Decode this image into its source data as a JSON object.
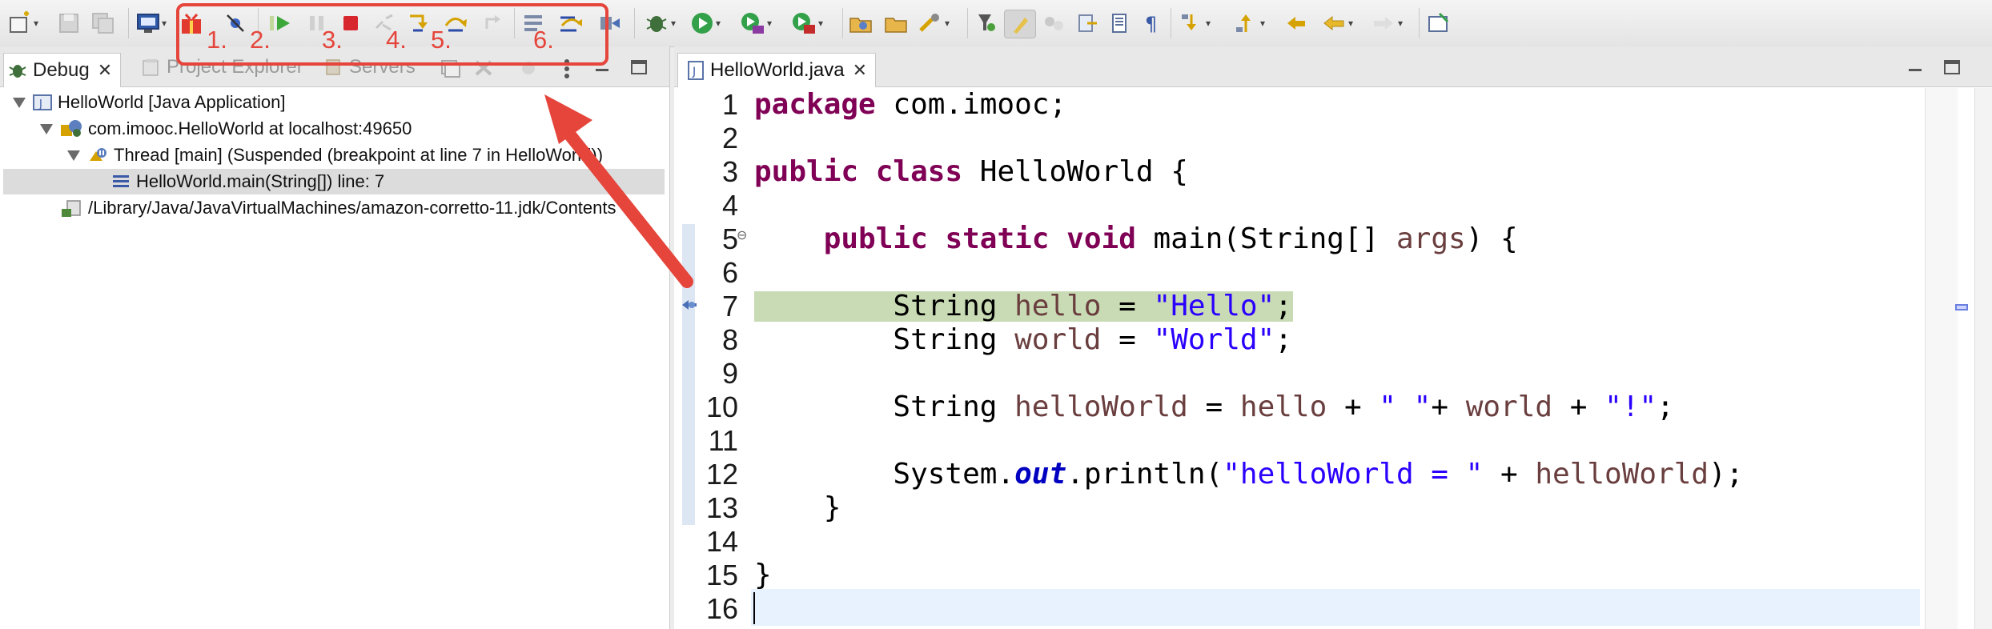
{
  "toolbar": {
    "icons": [
      "new-wizard-icon",
      "save-icon",
      "save-all-icon",
      "terminal-icon",
      "package-gift-icon",
      "skip-breakpoints-icon",
      "resume-icon",
      "suspend-icon",
      "terminate-icon",
      "disconnect-icon",
      "step-into-icon",
      "step-over-icon",
      "step-return-icon",
      "drop-to-frame-icon",
      "use-step-filters-icon",
      "debug-icon",
      "run-icon",
      "coverage-icon",
      "external-tools-icon",
      "open-type-icon",
      "open-folder-icon",
      "search-icon",
      "toggle-mark-occurrences-icon",
      "highlight-icon",
      "show-whitespace-icon",
      "next-annotation-icon",
      "previous-annotation-icon",
      "back-icon",
      "forward-icon",
      "pin-editor-icon"
    ]
  },
  "annotation": {
    "color": "#e5453b",
    "numbers": [
      "1.",
      "2.",
      "3.",
      "4.",
      "5.",
      "6."
    ]
  },
  "left_panel": {
    "tabs": [
      {
        "label": "Debug",
        "active": true
      },
      {
        "label": "Project Explorer",
        "active": false
      },
      {
        "label": "Servers",
        "active": false
      }
    ],
    "tree": [
      {
        "label": "HelloWorld [Java Application]"
      },
      {
        "label": "com.imooc.HelloWorld at localhost:49650"
      },
      {
        "label": "Thread [main] (Suspended (breakpoint at line 7 in HelloWorld))"
      },
      {
        "label": "HelloWorld.main(String[]) line: 7"
      },
      {
        "label": "/Library/Java/JavaVirtualMachines/amazon-corretto-11.jdk/Contents"
      }
    ]
  },
  "editor": {
    "tab_label": "HelloWorld.java",
    "line_numbers": [
      "1",
      "2",
      "3",
      "4",
      "5",
      "6",
      "7",
      "8",
      "9",
      "10",
      "11",
      "12",
      "13",
      "14",
      "15",
      "16"
    ],
    "tokens": {
      "package": "package",
      "pkg_name": " com.imooc;",
      "public": "public",
      "class": "class",
      "class_rest": " HelloWorld {",
      "indent4": "    ",
      "indent8": "        ",
      "static": "static",
      "void": "void",
      "main_sig": " main(String[] ",
      "args": "args",
      "main_end": ") {",
      "String": "String ",
      "hello": "hello",
      "eq": " = ",
      "hello_str": "\"Hello\"",
      "semi": ";",
      "world": "world",
      "world_str": "\"World\"",
      "helloWorld": "helloWorld",
      "plus": " + ",
      "space_str": "\" \"",
      "plus2": "+ ",
      "bang_str": "\"!\"",
      "system": "System.",
      "out": "out",
      "println": ".println(",
      "msg_str": "\"helloWorld = \"",
      "close_paren": ");",
      "brace_close": "}",
      "sp": " "
    }
  }
}
